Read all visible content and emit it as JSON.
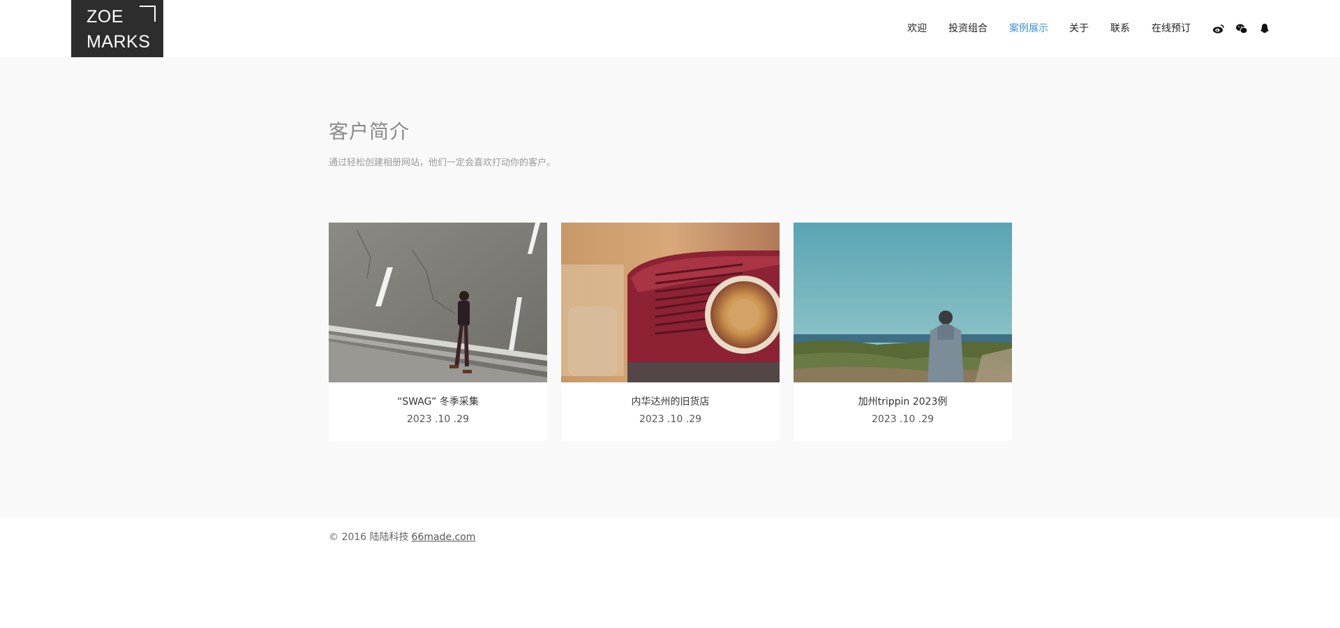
{
  "logo": {
    "line1": "ZOE",
    "line2": "MARKS"
  },
  "nav": {
    "items": [
      {
        "label": "欢迎"
      },
      {
        "label": "投资组合"
      },
      {
        "label": "案例展示",
        "active": true
      },
      {
        "label": "关于"
      },
      {
        "label": "联系"
      },
      {
        "label": "在线预订"
      }
    ],
    "active_color": "#3b8fd6"
  },
  "social": [
    "weibo-icon",
    "wechat-icon",
    "qq-icon"
  ],
  "section": {
    "title": "客户简介",
    "subtitle": "通过轻松创建相册网站，他们一定会喜欢打动你的客户。"
  },
  "cards": [
    {
      "title": "“SWAG” 冬季采集",
      "date": "2023 .10 .29",
      "image": "man walking on road"
    },
    {
      "title": "内华达州的旧货店",
      "date": "2023 .10 .29",
      "image": "vintage red radio"
    },
    {
      "title": "加州trippin 2023例",
      "date": "2023 .10 .29",
      "image": "person on coast"
    }
  ],
  "footer": {
    "copyright": "© 2016 陆陆科技",
    "link": "66made.com"
  },
  "colors": {
    "logo_bg": "#2d2d2d",
    "main_bg": "#f9f9f9",
    "accent": "#3b8fd6"
  }
}
